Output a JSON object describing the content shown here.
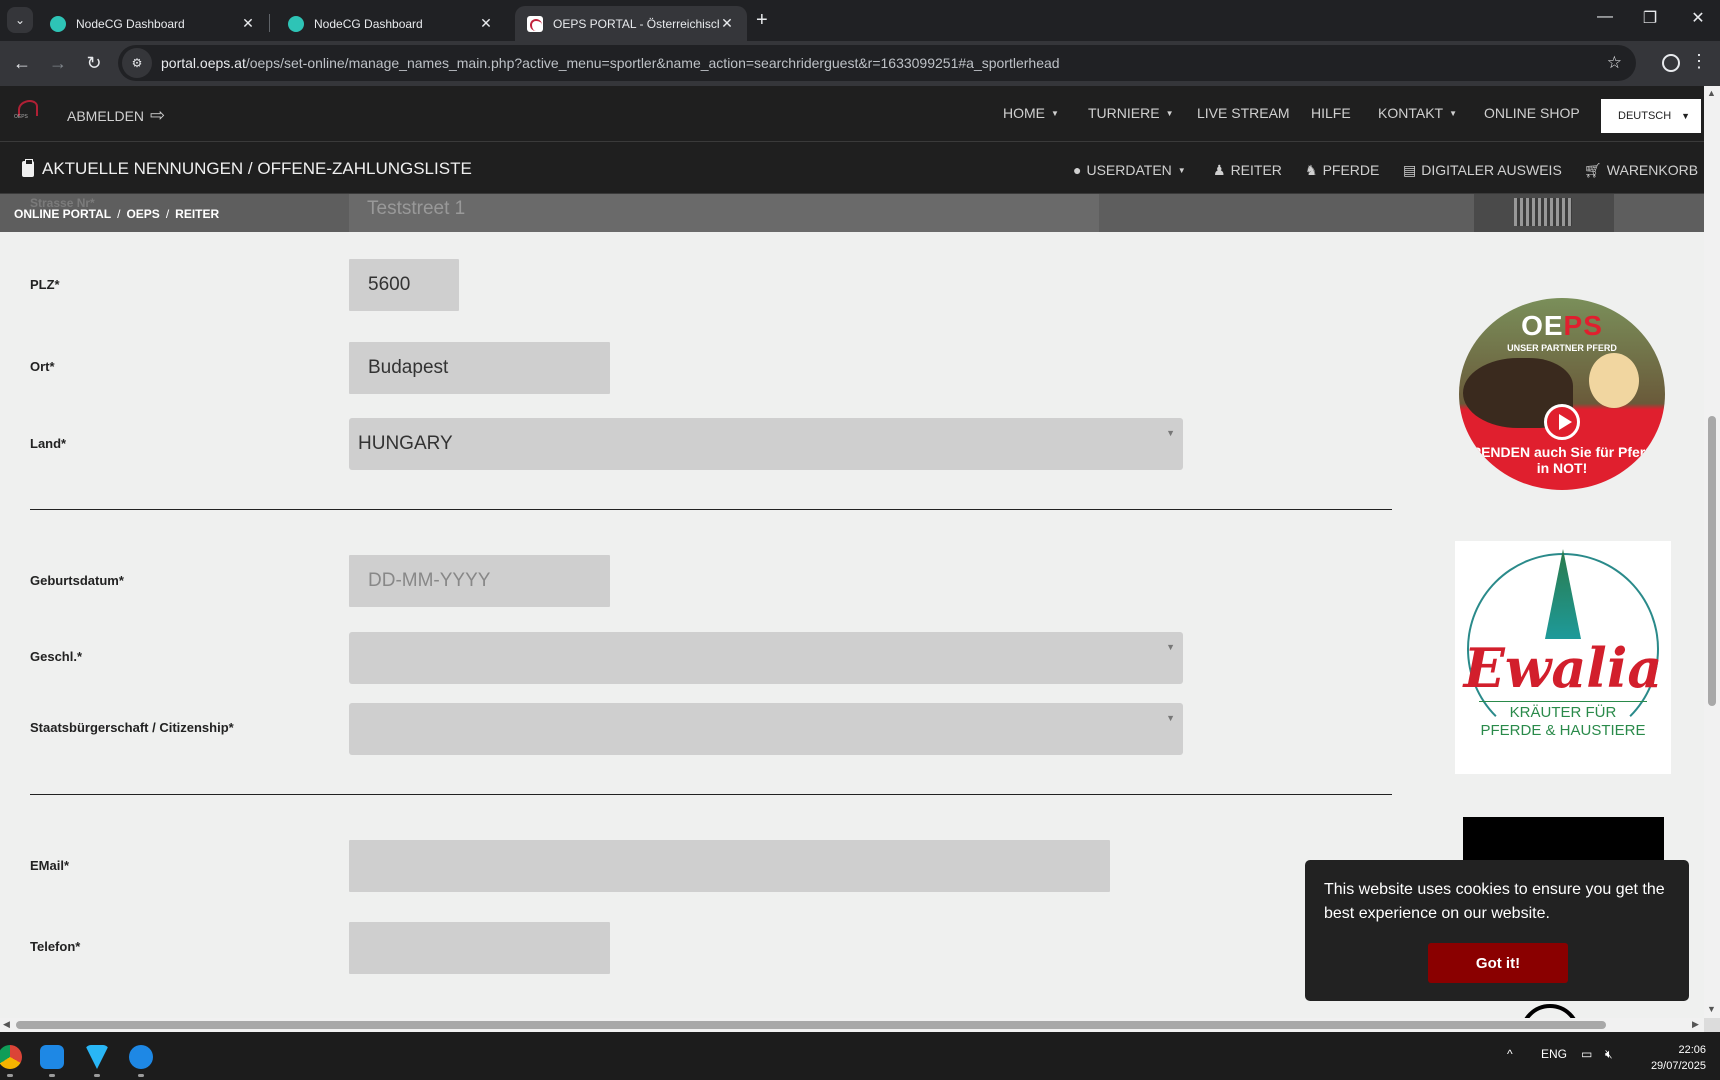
{
  "browser": {
    "tabs": [
      {
        "title": "NodeCG Dashboard",
        "active": false
      },
      {
        "title": "NodeCG Dashboard",
        "active": false
      },
      {
        "title": "OEPS PORTAL - Österreichische",
        "active": true
      }
    ],
    "url_host": "portal.oeps.at",
    "url_path": "/oeps/set-online/manage_names_main.php?active_menu=sportler&name_action=searchriderguest&r=1633099251#a_sportlerhead"
  },
  "site": {
    "logout_label": "ABMELDEN",
    "menu": [
      "HOME",
      "TURNIERE",
      "LIVE STREAM",
      "HILFE",
      "KONTAKT",
      "ONLINE SHOP"
    ],
    "language": "DEUTSCH",
    "page_title": "AKTUELLE NENNUNGEN / OFFENE-ZAHLUNGSLISTE",
    "submenu": [
      "USERDATEN",
      "REITER",
      "PFERDE",
      "DIGITALER AUSWEIS",
      "WARENKORB"
    ],
    "breadcrumb": [
      "ONLINE PORTAL",
      "OEPS",
      "REITER"
    ]
  },
  "form": {
    "street_label": "Strasse Nr*",
    "street_value": "Teststreet 1",
    "plz_label": "PLZ*",
    "plz_value": "5600",
    "ort_label": "Ort*",
    "ort_value": "Budapest",
    "land_label": "Land*",
    "land_value": "HUNGARY",
    "geburtsdatum_label": "Geburtsdatum*",
    "geburtsdatum_placeholder": "DD-MM-YYYY",
    "geschl_label": "Geschl.*",
    "geschl_value": "",
    "staat_label": "Staatsbürgerschaft / Citizenship*",
    "staat_value": "",
    "email_label": "EMail*",
    "email_value": "",
    "telefon_label": "Telefon*",
    "telefon_value": ""
  },
  "ads": {
    "oeps_brand_a": "OE",
    "oeps_brand_b": "PS",
    "oeps_tagline": "UNSER PARTNER PFERD",
    "oeps_cta": "SPENDEN auch Sie für Pferde in NOT!",
    "ewalia_name": "Ewalia",
    "ewalia_sub1": "KRÄUTER FÜR",
    "ewalia_sub2": "PFERDE & HAUSTIERE"
  },
  "cookie": {
    "message": "This website uses cookies to ensure you get the best experience on our website.",
    "button": "Got it!"
  },
  "taskbar": {
    "lang": "ENG",
    "time": "22:06",
    "date": "29/07/2025"
  }
}
